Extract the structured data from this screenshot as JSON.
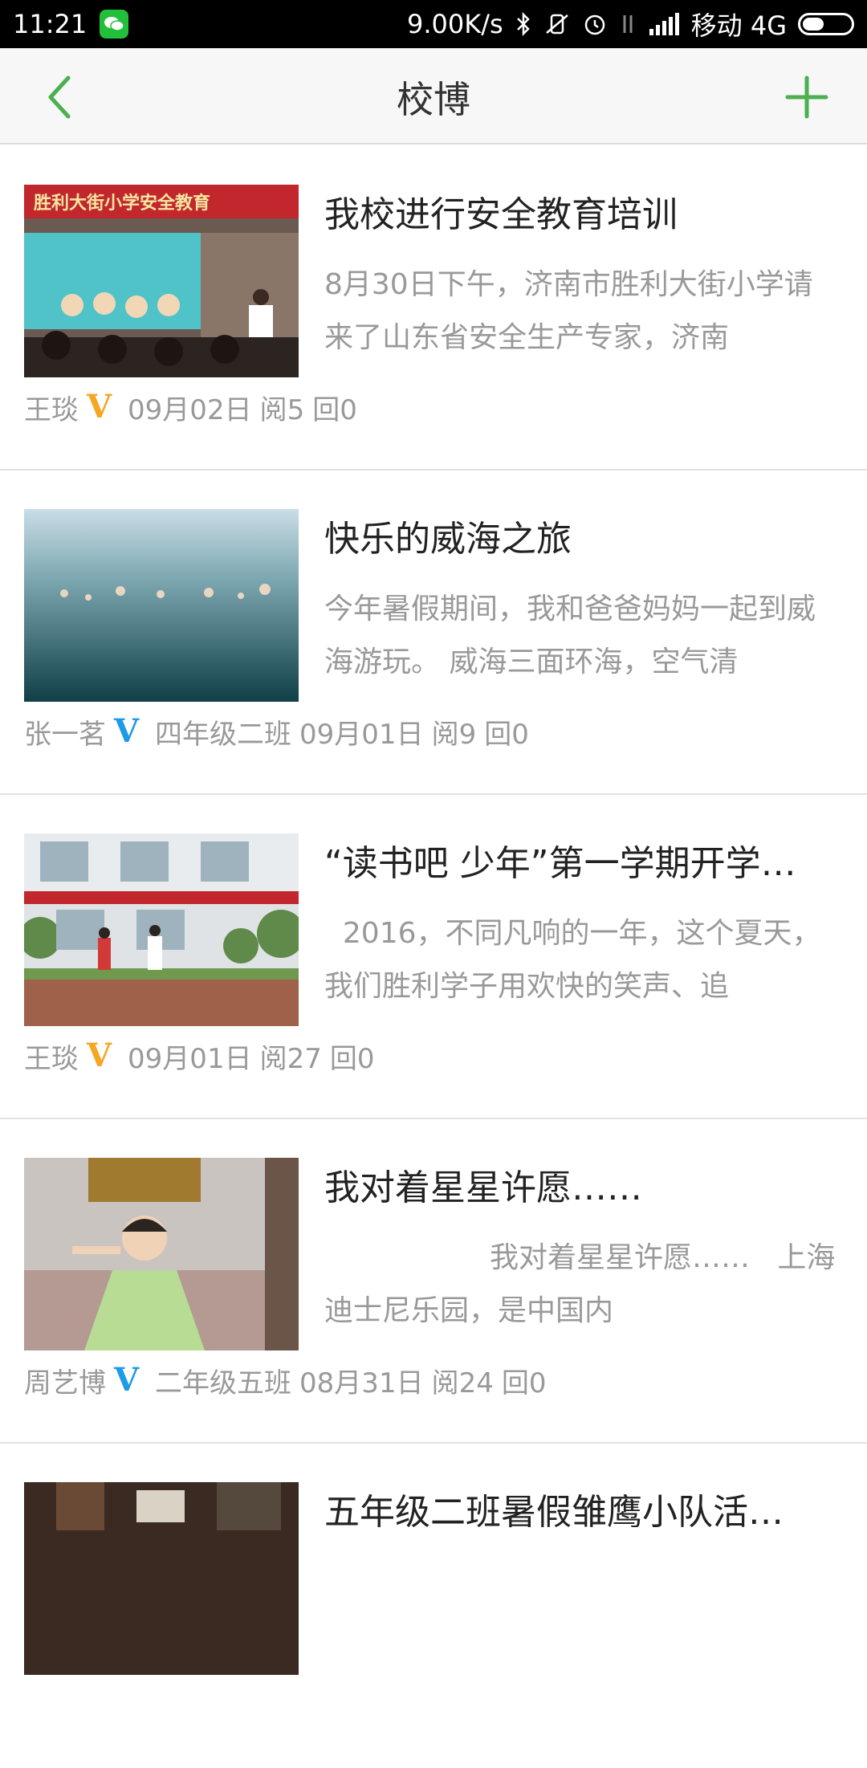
{
  "status_bar": {
    "time": "11:21",
    "net_speed": "9.00K/s",
    "carrier": "移动 4G"
  },
  "header": {
    "title": "校博"
  },
  "posts": [
    {
      "title": "我校进行安全教育培训",
      "summary": "8月30日下午，济南市胜利大街小学请来了山东省安全生产专家，济南",
      "author": "王琰",
      "badge_color": "#f5a623",
      "class_name": "",
      "date": "09月02日",
      "reads": "阅5",
      "replies": "回0",
      "banner_text": "胜利大街小学安全教育"
    },
    {
      "title": "快乐的威海之旅",
      "summary": "今年暑假期间，我和爸爸妈妈一起到威海游玩。 威海三面环海，空气清",
      "author": "张一茗",
      "badge_color": "#1e9be6",
      "class_name": "四年级二班",
      "date": "09月01日",
      "reads": "阅9",
      "replies": "回0"
    },
    {
      "title": "“读书吧 少年”第一学期开学…",
      "summary": "  2016，不同凡响的一年，这个夏天，我们胜利学子用欢快的笑声、追",
      "author": "王琰",
      "badge_color": "#f5a623",
      "class_name": "",
      "date": "09月01日",
      "reads": "阅27",
      "replies": "回0"
    },
    {
      "title": "我对着星星许愿……",
      "summary": "                  我对着星星许愿……   上海迪士尼乐园，是中国内",
      "author": "周艺博",
      "badge_color": "#1e9be6",
      "class_name": "二年级五班",
      "date": "08月31日",
      "reads": "阅24",
      "replies": "回0"
    },
    {
      "title": "五年级二班暑假雏鹰小队活…",
      "summary": "",
      "author": "",
      "badge_color": "#1e9be6",
      "class_name": "",
      "date": "",
      "reads": "",
      "replies": ""
    }
  ],
  "badge_letter": "V"
}
